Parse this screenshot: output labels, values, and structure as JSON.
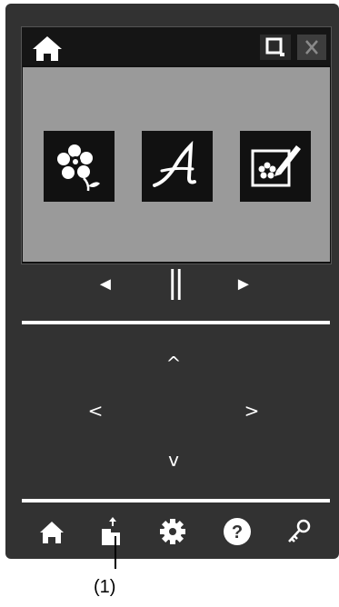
{
  "colors": {
    "device_body": "#323232",
    "screen_content": "#9a9a9a",
    "tile_bg": "#111111",
    "foreground": "#ffffff"
  },
  "screen": {
    "titlebar": {
      "left_icon": "home-icon",
      "right_icons": [
        "zoom-icon",
        "close-icon"
      ]
    },
    "tiles": [
      {
        "icon": "flower-pattern-icon"
      },
      {
        "icon": "letter-a-icon",
        "glyph": "A"
      },
      {
        "icon": "edit-pattern-icon"
      }
    ]
  },
  "playback": {
    "prev": "◄",
    "pause": "||",
    "next": "►"
  },
  "directional": {
    "up": "^",
    "left": "<",
    "right": ">",
    "down": "v"
  },
  "bottom_bar": [
    "home-icon",
    "upload-icon",
    "settings-gear-icon",
    "help-icon",
    "key-icon"
  ],
  "callout": {
    "label": "(1)"
  }
}
